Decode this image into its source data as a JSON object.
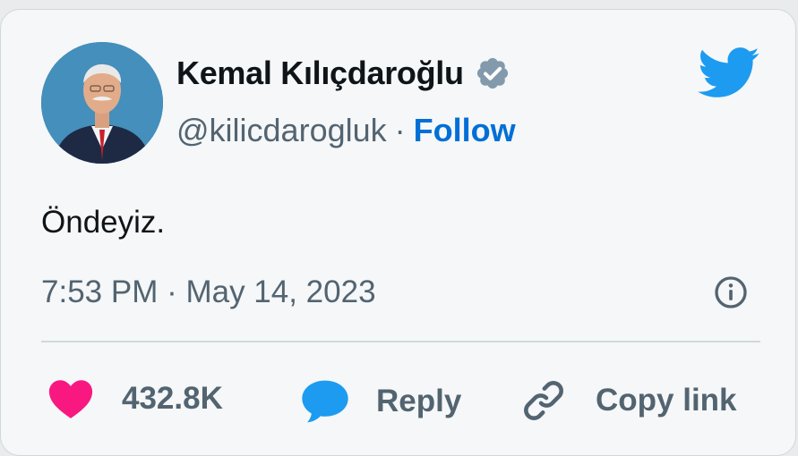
{
  "author": {
    "display_name": "Kemal Kılıçdaroğlu",
    "handle": "@kilicdarogluk",
    "separator": "·",
    "follow_label": "Follow",
    "verified": true
  },
  "tweet": {
    "text": "Öndeyiz.",
    "timestamp": "7:53 PM · May 14, 2023"
  },
  "actions": {
    "like_count": "432.8K",
    "reply_label": "Reply",
    "copy_link_label": "Copy link"
  },
  "icons": {
    "logo": "twitter-bird-icon",
    "verified": "verified-badge-icon",
    "info": "info-icon",
    "like": "heart-icon",
    "reply": "reply-bubble-icon",
    "copy": "link-icon"
  },
  "colors": {
    "accent": "#1d9bf0",
    "follow": "#006fd6",
    "like": "#f91880",
    "text": "#0f1419",
    "muted": "#536471",
    "background": "#f5f7f8"
  }
}
